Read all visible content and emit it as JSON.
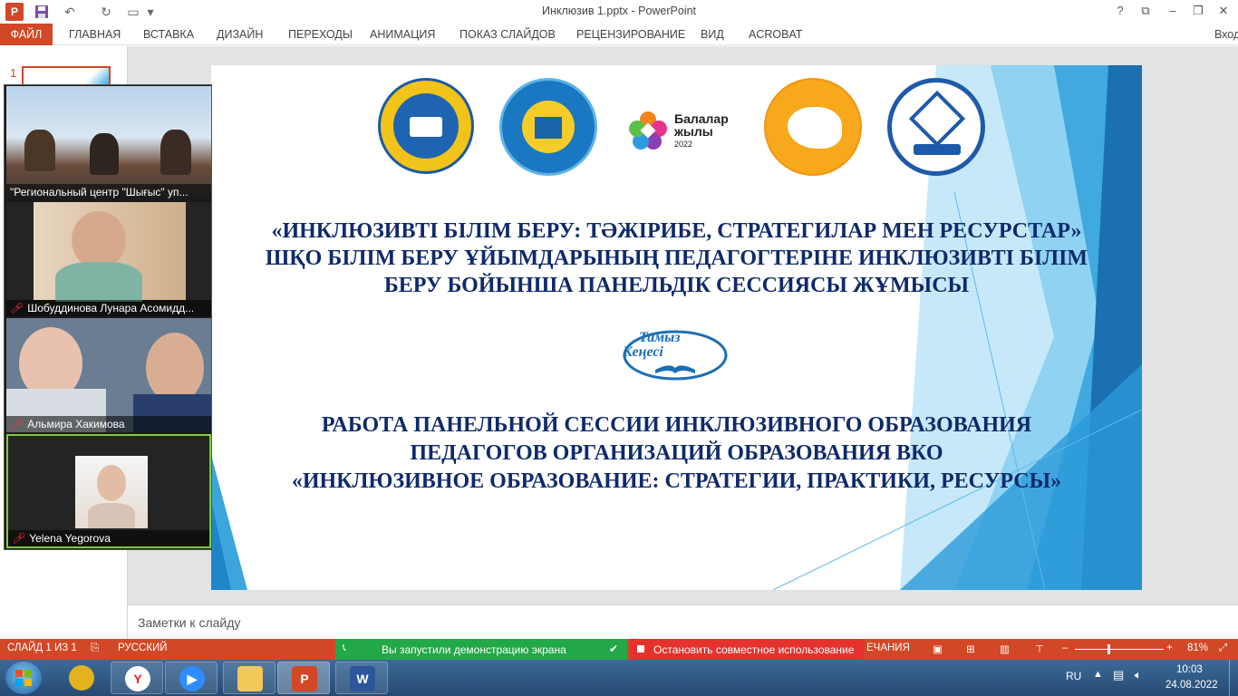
{
  "window": {
    "title": "Инклюзив 1.pptx - PowerPoint",
    "help": "?",
    "app_letter": "P"
  },
  "ribbon": {
    "tabs": [
      "ФАЙЛ",
      "ГЛАВНАЯ",
      "ВСТАВКА",
      "ДИЗАЙН",
      "ПЕРЕХОДЫ",
      "АНИМАЦИЯ",
      "ПОКАЗ СЛАЙДОВ",
      "РЕЦЕНЗИРОВАНИЕ",
      "ВИД",
      "ACROBAT"
    ],
    "signin": "Вход"
  },
  "thumbnails": {
    "current_number": "1"
  },
  "slide": {
    "logo_balalar_line1": "Балалар",
    "logo_balalar_line2": "жылы",
    "logo_balalar_year": "2022",
    "logo_tamyz_line1": "Тамыз",
    "logo_tamyz_line2": "Кеңесі",
    "kz_title_line1": "«ИНКЛЮЗИВТІ БІЛІМ БЕРУ: ТӘЖІРИБЕ, СТРАТЕГИЛАР МЕН РЕСУРСТАР»",
    "kz_title_line2": "ШҚО БІЛІМ БЕРУ ҰЙЫМДАРЫНЫҢ ПЕДАГОГТЕРІНЕ ИНКЛЮЗИВТІ БІЛІМ",
    "kz_title_line3": "БЕРУ БОЙЫНША ПАНЕЛЬДІК СЕССИЯСЫ ЖҰМЫСЫ",
    "ru_title_line1": "РАБОТА ПАНЕЛЬНОЙ СЕССИИ ИНКЛЮЗИВНОГО ОБРАЗОВАНИЯ",
    "ru_title_line2": "ПЕДАГОГОВ  ОРГАНИЗАЦИЙ ОБРАЗОВАНИЯ ВКО",
    "ru_title_line3": "«ИНКЛЮЗИВНОЕ ОБРАЗОВАНИЕ: СТРАТЕГИИ, ПРАКТИКИ, РЕСУРСЫ»"
  },
  "notes": {
    "placeholder": "Заметки к слайду"
  },
  "zoom": {
    "participants": [
      {
        "name": "\"Региональный центр \"Шығыс\" уп...",
        "muted": false
      },
      {
        "name": "Шобуддинова Лунара Асомидд...",
        "muted": true
      },
      {
        "name": "Альмира Хакимова",
        "muted": true
      },
      {
        "name": "Yelena Yegorova",
        "muted": true
      }
    ],
    "share_status": "Вы запустили демонстрацию экрана",
    "stop_share": "Остановить совместное использование"
  },
  "statusbar": {
    "slide_counter": "СЛАЙД 1 ИЗ 1",
    "language": "РУССКИЙ",
    "notes_partial": "ЕЧАНИЯ",
    "zoom_level": "81%",
    "accent": "#d24726"
  },
  "taskbar": {
    "lang": "RU",
    "time": "10:03",
    "date": "24.08.2022"
  }
}
